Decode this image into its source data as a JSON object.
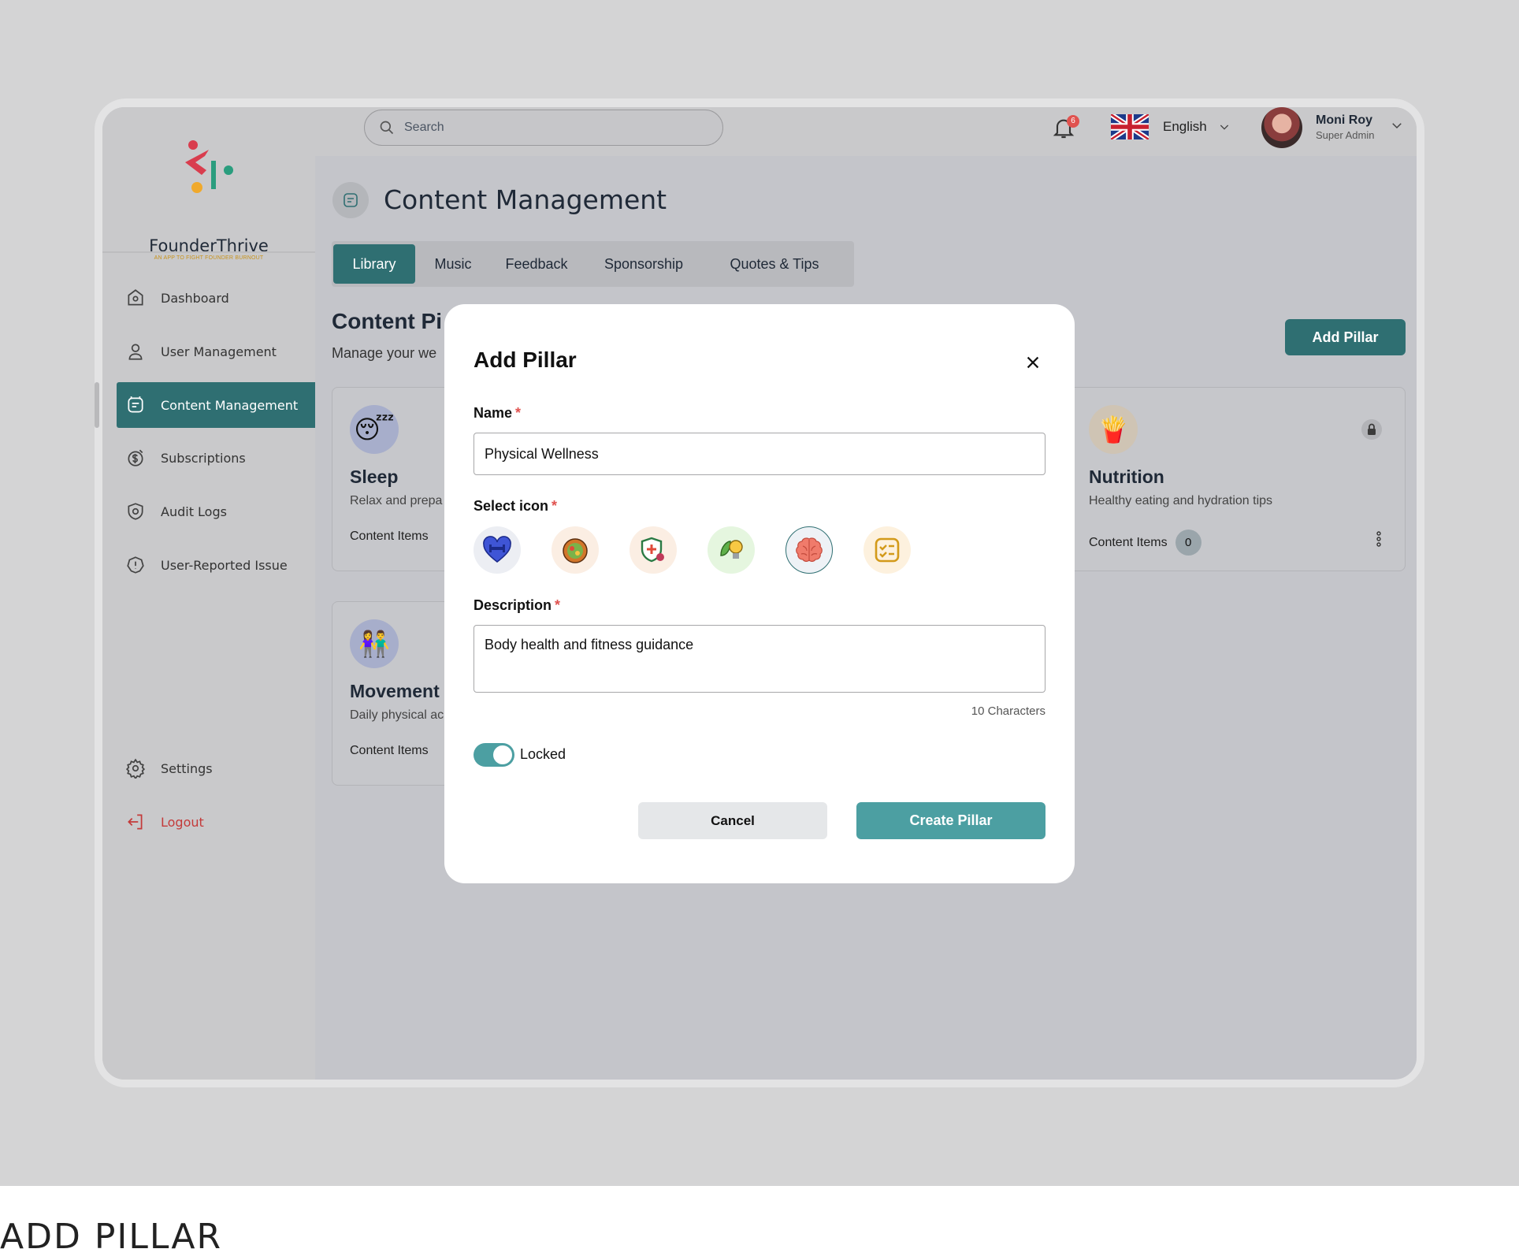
{
  "brand": {
    "name": "FounderThrive",
    "tagline": "AN APP TO FIGHT FOUNDER BURNOUT"
  },
  "sidebar": {
    "items": [
      {
        "label": "Dashboard",
        "icon": "home-icon"
      },
      {
        "label": "User  Management",
        "icon": "user-icon"
      },
      {
        "label": "Content Management",
        "icon": "content-icon",
        "active": true
      },
      {
        "label": "Subscriptions",
        "icon": "dollar-icon"
      },
      {
        "label": "Audit Logs",
        "icon": "shield-icon"
      },
      {
        "label": "User-Reported Issue",
        "icon": "alert-icon"
      }
    ],
    "bottom": [
      {
        "label": "Settings",
        "icon": "gear-icon"
      },
      {
        "label": "Logout",
        "icon": "logout-icon"
      }
    ]
  },
  "topbar": {
    "search_placeholder": "Search",
    "notification_count": "6",
    "language": "English",
    "user": {
      "name": "Moni Roy",
      "role": "Super Admin"
    }
  },
  "page": {
    "title": "Content Management",
    "tabs": [
      "Library",
      "Music",
      "Feedback",
      "Sponsorship",
      "Quotes & Tips"
    ],
    "active_tab": "Library",
    "section_title": "Content Pi",
    "section_sub": "Manage your we",
    "add_pillar_label": "Add Pillar"
  },
  "cards": [
    {
      "title": "Sleep",
      "desc": "Relax and prepa",
      "items_label": "Content Items",
      "emoji": "😴"
    },
    {
      "title": "Nutrition",
      "desc": "Healthy eating and hydration tips",
      "items_label": "Content Items",
      "count": "0",
      "emoji": "🍟"
    },
    {
      "title": "Movement",
      "desc": "Daily physical ac",
      "items_label": "Content Items",
      "emoji": "👫"
    }
  ],
  "modal": {
    "title": "Add Pillar",
    "name_label": "Name",
    "name_value": "Physical Wellness",
    "icon_label": "Select icon",
    "icons": [
      "heart-dumbbell-icon",
      "food-bowl-icon",
      "health-shield-icon",
      "leaf-bulb-icon",
      "brain-icon",
      "checklist-icon"
    ],
    "selected_icon": "brain-icon",
    "description_label": "Description",
    "description_value": "Body health and fitness guidance",
    "char_count": "10 Characters",
    "locked_label": "Locked",
    "locked": true,
    "cancel_label": "Cancel",
    "create_label": "Create Pillar"
  },
  "caption": "ADD PILLAR",
  "colors": {
    "primary": "#2f6f72",
    "accent": "#4c9fa2",
    "danger": "#e0524f"
  }
}
